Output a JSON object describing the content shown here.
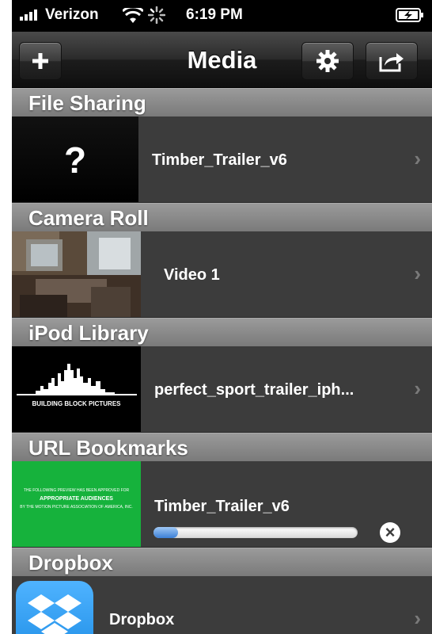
{
  "status_bar": {
    "carrier": "Verizon",
    "time": "6:19 PM",
    "icons": [
      "signal-bars-icon",
      "wifi-icon",
      "activity-spinner-icon",
      "battery-charging-icon"
    ]
  },
  "nav": {
    "title": "Media",
    "add_icon": "plus-icon",
    "settings_icon": "gear-icon",
    "share_icon": "share-icon"
  },
  "sections": [
    {
      "header": "File Sharing",
      "item": {
        "title": "Timber_Trailer_v6",
        "thumb_text": "?"
      }
    },
    {
      "header": "Camera Roll",
      "item": {
        "title": "Video 1"
      }
    },
    {
      "header": "iPod Library",
      "item": {
        "title": "perfect_sport_trailer_iph...",
        "thumb_caption": "BUILDING BLOCK PICTURES"
      }
    },
    {
      "header": "URL Bookmarks",
      "item": {
        "title": "Timber_Trailer_v6",
        "progress": 0.12,
        "thumb_line1": "THE FOLLOWING PREVIEW HAS BEEN APPROVED FOR",
        "thumb_line2": "APPROPRIATE AUDIENCES",
        "thumb_line3": "BY THE MOTION PICTURE ASSOCIATION OF AMERICA, INC.",
        "cancel_icon": "close-circle-icon"
      }
    },
    {
      "header": "Dropbox",
      "item": {
        "title": "Dropbox",
        "icon": "dropbox-icon"
      }
    }
  ],
  "colors": {
    "progress": "#3b7fd6",
    "header_bg": "#8a8a8a",
    "row_bg": "#3c3c3c",
    "thumb_green": "#16b23c",
    "dropbox_blue": "#1f8ee6"
  }
}
